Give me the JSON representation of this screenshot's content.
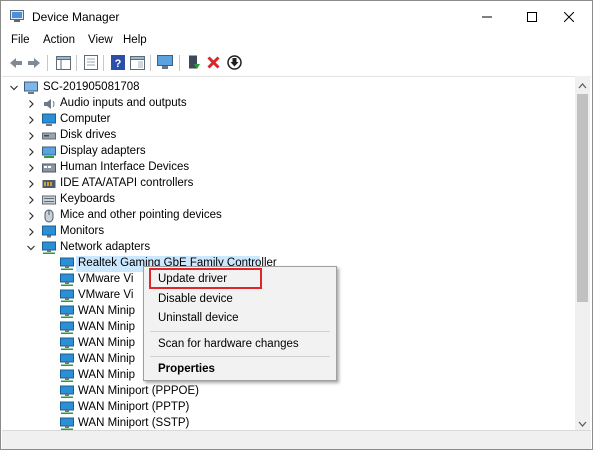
{
  "window": {
    "title": "Device Manager"
  },
  "menubar": {
    "file": "File",
    "action": "Action",
    "view": "View",
    "help": "Help"
  },
  "toolbar": {
    "buttons": [
      "back-arrow",
      "forward-arrow",
      "properties-pane",
      "show-hide",
      "help",
      "console-tree",
      "monitor-scan",
      "enable-device",
      "uninstall-x",
      "update-down"
    ]
  },
  "tree": {
    "root": "SC-201905081708",
    "categories": {
      "audio": "Audio inputs and outputs",
      "computer": "Computer",
      "disk": "Disk drives",
      "display": "Display adapters",
      "hid": "Human Interface Devices",
      "ide": "IDE ATA/ATAPI controllers",
      "keyboards": "Keyboards",
      "mice": "Mice and other pointing devices",
      "monitors": "Monitors",
      "network": "Network adapters"
    },
    "network_items": [
      "Realtek Gaming GbE Family Controller",
      "VMware Vi",
      "VMware Vi",
      "WAN Minip",
      "WAN Minip",
      "WAN Minip",
      "WAN Minip",
      "WAN Minip",
      "WAN Miniport (PPPOE)",
      "WAN Miniport (PPTP)",
      "WAN Miniport (SSTP)"
    ]
  },
  "context_menu": {
    "update": "Update driver",
    "disable": "Disable device",
    "uninstall": "Uninstall device",
    "scan": "Scan for hardware changes",
    "properties": "Properties"
  },
  "colors": {
    "selection": "#cce8ff",
    "highlight_border": "#e0262a",
    "network_icon": "#2b8fd6",
    "uninstall_red": "#d8262b",
    "enable_green": "#2a9d3b"
  }
}
